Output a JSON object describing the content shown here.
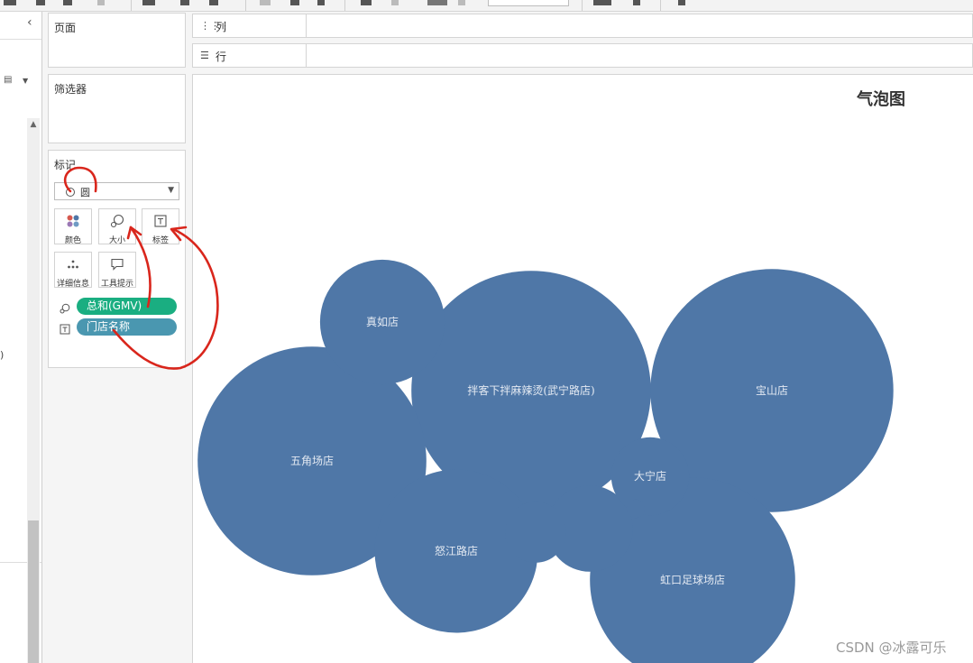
{
  "cards": {
    "pages_label": "页面",
    "filters_label": "筛选器",
    "marks_label": "标记"
  },
  "marks": {
    "mark_type": "圆",
    "buttons": {
      "color": "颜色",
      "size": "大小",
      "label": "标签",
      "detail": "详细信息",
      "tooltip": "工具提示"
    },
    "shelf": [
      {
        "kind": "size-icon",
        "field": "总和(GMV)",
        "color": "#1aae81"
      },
      {
        "kind": "text-icon",
        "field": "门店名称",
        "color": "#4a97b0"
      }
    ]
  },
  "shelves": {
    "columns_label": "列",
    "rows_label": "行"
  },
  "left_pane": {
    "paren": ")"
  },
  "viz": {
    "title": "气泡图",
    "bubble_color": "#4f77a7",
    "label_color": "#e3e9f2"
  },
  "chart_data": {
    "type": "scatter",
    "title": "气泡图",
    "encoding": "bubble size = 总和(GMV), label = 门店名称",
    "bubbles": [
      {
        "label": "拌客下拌麻辣烫(武宁路店)",
        "size": 17
      },
      {
        "label": "宝山店",
        "size": 17.5
      },
      {
        "label": "五角场店",
        "size": 15.5
      },
      {
        "label": "虹口足球场店",
        "size": 12.5
      },
      {
        "label": "怒江路店",
        "size": 7.9
      },
      {
        "label": "真如店",
        "size": 4.6
      },
      {
        "label": "",
        "size": 2.2
      },
      {
        "label": "大宁店",
        "size": 1.8
      },
      {
        "label": "",
        "size": 1.1
      },
      {
        "label": "",
        "size": 0.1
      }
    ]
  },
  "watermark": "CSDN @冰露可乐"
}
